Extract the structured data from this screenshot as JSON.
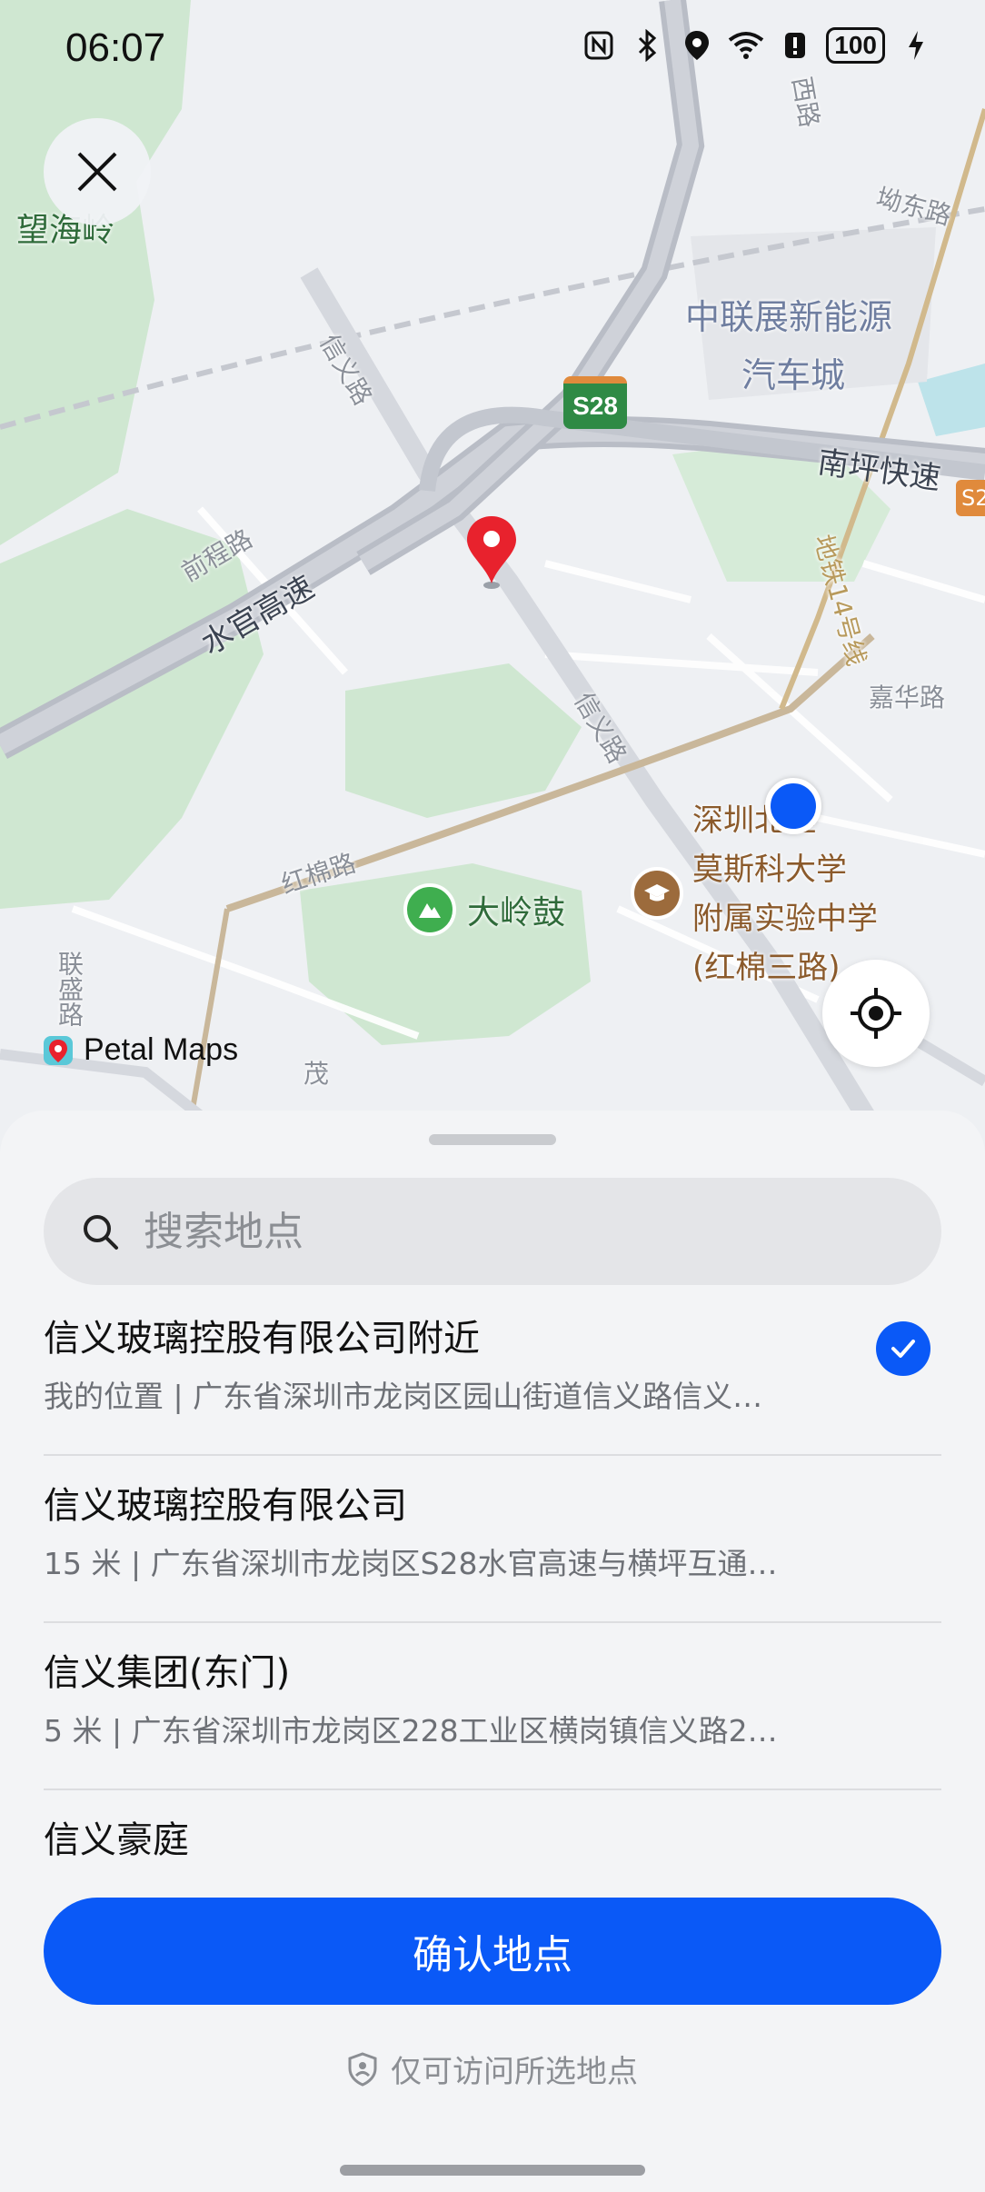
{
  "status_bar": {
    "time": "06:07",
    "battery": "100",
    "icons": [
      "nfc-icon",
      "bluetooth-icon",
      "location-icon",
      "wifi-icon",
      "alarm-icon",
      "battery-icon",
      "charging-icon"
    ]
  },
  "map": {
    "attribution": "Petal Maps",
    "labels": {
      "wanghai": "望海岭",
      "expo": "中联展新能源",
      "expo2": "汽车城",
      "xinyi_road_1": "信义路",
      "xinyi_road_2": "信义路",
      "s28": "S28",
      "nanping": "南坪快速",
      "s2": "S2",
      "qiancheng": "前程路",
      "shuiguan": "水官高速",
      "metro14": "地铁14号线",
      "jiahua": "嘉华路",
      "aodong": "坳东路",
      "hongmian": "红棉路",
      "daling": "大岭鼓",
      "school1": "深圳北理",
      "school2": "莫斯科大学",
      "school3": "附属实验中学",
      "school4": "(红棉三路)",
      "liansheng": "联盛路",
      "mao": "茂",
      "xi": "西路"
    }
  },
  "search": {
    "placeholder": "搜索地点"
  },
  "places": [
    {
      "name": "信义玻璃控股有限公司附近",
      "detail": "我的位置 | 广东省深圳市龙岗区园山街道信义路信义…",
      "selected": true
    },
    {
      "name": "信义玻璃控股有限公司",
      "detail": "15 米 | 广东省深圳市龙岗区S28水官高速与横坪互通…",
      "selected": false
    },
    {
      "name": "信义集团(东门)",
      "detail": "5 米 | 广东省深圳市龙岗区228工业区横岗镇信义路2…",
      "selected": false
    },
    {
      "name": "信义豪庭",
      "detail": "",
      "selected": false
    }
  ],
  "confirm_label": "确认地点",
  "privacy_text": "仅可访问所选地点",
  "colors": {
    "accent": "#0A59F7",
    "pin": "#E8222D",
    "park": "#CDE8CF",
    "road": "#D9DCE2"
  }
}
